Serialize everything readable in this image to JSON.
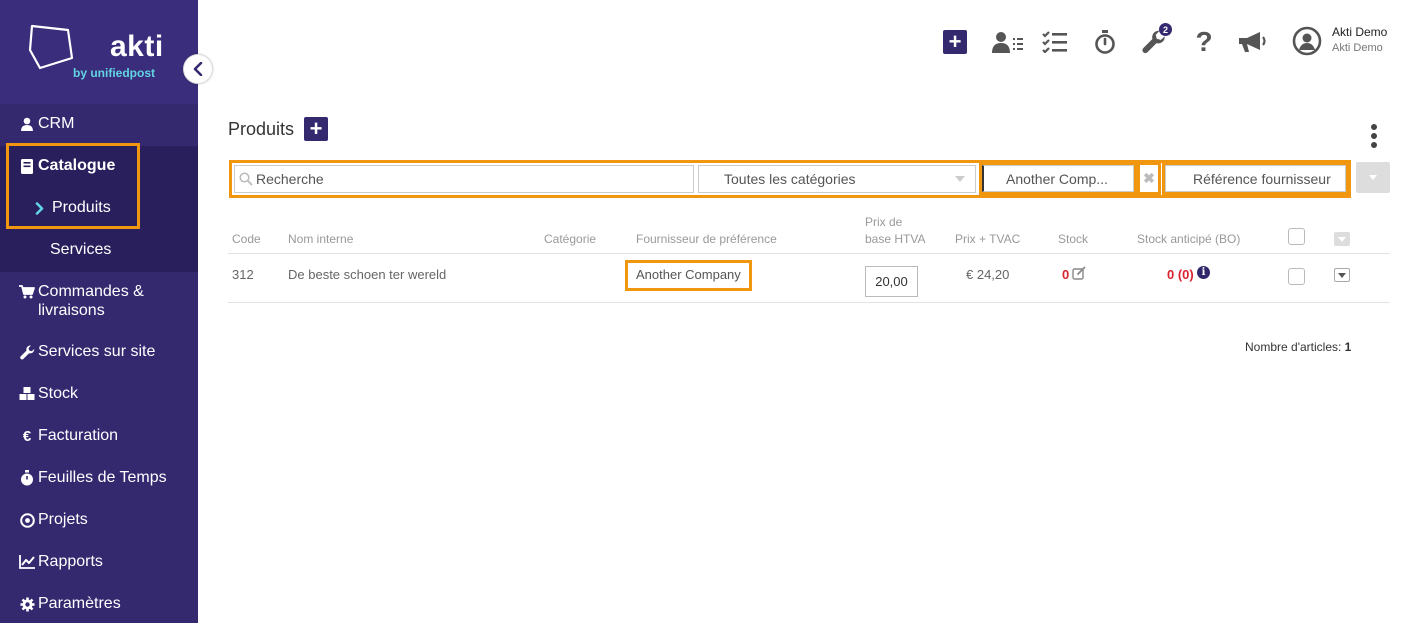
{
  "brand": {
    "name": "akti",
    "sub": "by unifiedpost"
  },
  "sidebar": {
    "items": [
      {
        "label": "CRM"
      },
      {
        "label": "Catalogue"
      },
      {
        "label": "Produits"
      },
      {
        "label": "Services"
      },
      {
        "label": "Commandes &",
        "label2": "livraisons"
      },
      {
        "label": "Services sur site"
      },
      {
        "label": "Stock"
      },
      {
        "label": "Facturation"
      },
      {
        "label": "Feuilles de Temps"
      },
      {
        "label": "Projets"
      },
      {
        "label": "Rapports"
      },
      {
        "label": "Paramètres"
      }
    ]
  },
  "topbar": {
    "tools_badge": "2",
    "user_name": "Akti Demo",
    "user_company": "Akti Demo"
  },
  "page": {
    "title": "Produits",
    "filters": {
      "search_placeholder": "Recherche",
      "category": "Toutes les catégories",
      "supplier": "Another Comp...",
      "supplier_ref": "Référence fournisseur"
    },
    "table": {
      "headers": {
        "code": "Code",
        "internal_name": "Nom interne",
        "category": "Catégorie",
        "supplier": "Fournisseur de préférence",
        "price_line1": "Prix de",
        "price_line2": "base HTVA",
        "price_tvac": "Prix + TVAC",
        "stock": "Stock",
        "stock_bo": "Stock anticipé (BO)"
      },
      "rows": [
        {
          "code": "312",
          "internal_name": "De beste schoen ter wereld",
          "category": "",
          "supplier": "Another Company",
          "price_htva": "20,00",
          "price_tvac": "€ 24,20",
          "stock": "0",
          "stock_bo": "0 (0)"
        }
      ]
    },
    "count_label": "Nombre d'articles:",
    "count_value": "1"
  },
  "colors": {
    "primary": "#34286f",
    "highlight": "#f0960f",
    "accent": "#62d3e2",
    "danger": "#d9232e"
  }
}
